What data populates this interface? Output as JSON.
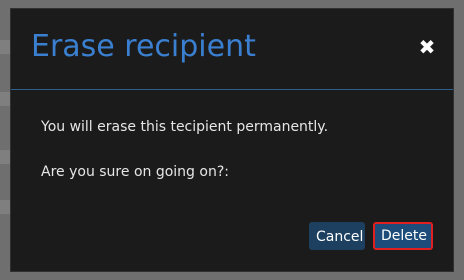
{
  "dialog": {
    "title": "Erase recipient",
    "close_icon": "close-icon",
    "message": "You will erase this tecipient permanently.",
    "question": "Are you sure on going on?:",
    "cancel_label": "Cancel",
    "delete_label": "Delete"
  },
  "colors": {
    "title": "#3a7fd0",
    "dialog_background": "#1b1b1b",
    "button_background": "#1d4060",
    "highlight_border": "#e02020"
  }
}
